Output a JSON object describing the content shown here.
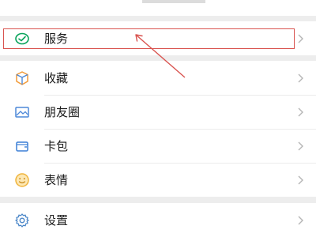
{
  "menu": {
    "service": {
      "label": "服务",
      "icon": "wechat-pay-check-icon"
    },
    "favorites": {
      "label": "收藏",
      "icon": "cube-icon"
    },
    "moments": {
      "label": "朋友圈",
      "icon": "image-icon"
    },
    "cards": {
      "label": "卡包",
      "icon": "wallet-icon"
    },
    "stickers": {
      "label": "表情",
      "icon": "smiley-icon"
    },
    "settings": {
      "label": "设置",
      "icon": "gear-icon"
    }
  },
  "colors": {
    "background": "#ededed",
    "highlight": "#d9534f",
    "service_green": "#07a35a",
    "favorites_orange": "#f29a38",
    "moments_blue": "#4d88d8",
    "cards_blue": "#3b7fd6",
    "stickers_yellow": "#f0b43c",
    "settings_blue": "#4a86c8"
  }
}
